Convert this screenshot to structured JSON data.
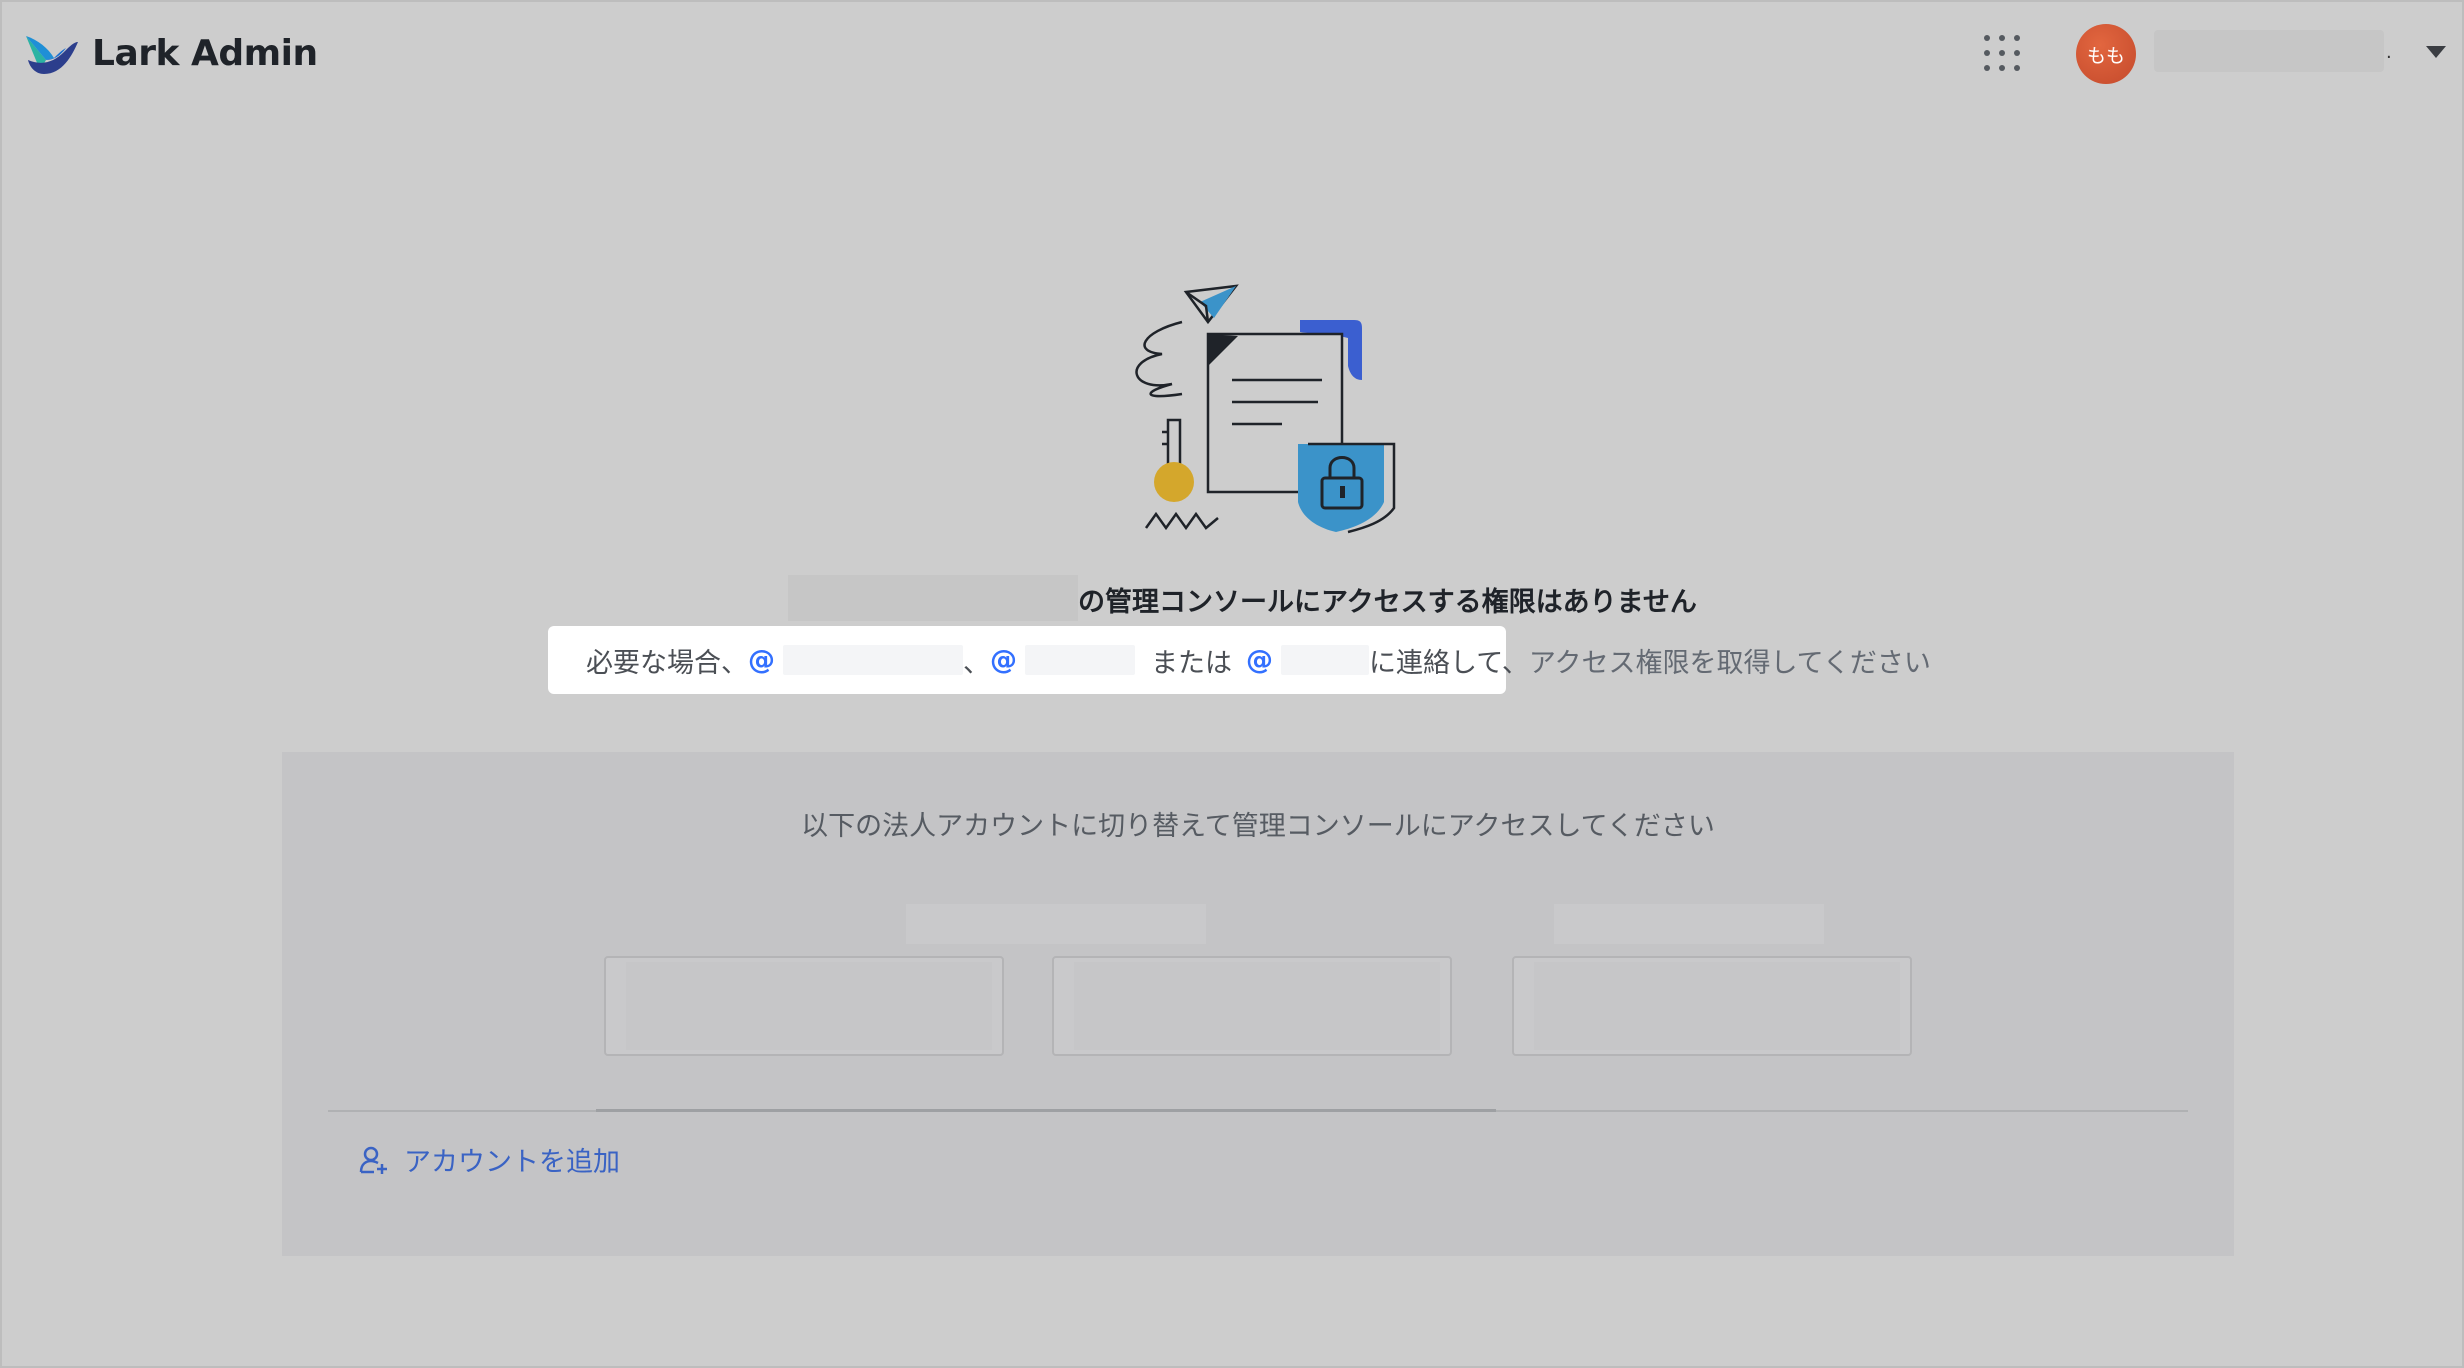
{
  "app": {
    "name": "Lark Admin"
  },
  "header": {
    "avatar_initials": "もも",
    "user_name_suffix": "."
  },
  "message": {
    "title_suffix": "の管理コンソールにアクセスする権限はありません",
    "contact_prefix": "必要な場合、",
    "at_symbol": "@",
    "separator": "、",
    "or_text": "または",
    "contact_middle": "に連絡して、",
    "contact_suffix": "アクセス権限を取得してください"
  },
  "switch_panel": {
    "title": "以下の法人アカウントに切り替えて管理コンソールにアクセスしてください",
    "add_account_label": "アカウントを追加"
  },
  "colors": {
    "accent": "#3370ff",
    "link": "#3a63c4",
    "avatar": "#d4583a",
    "illustration_blue": "#3b5fd0",
    "illustration_cyan": "#3b93c9",
    "illustration_gold": "#d4a72c"
  }
}
